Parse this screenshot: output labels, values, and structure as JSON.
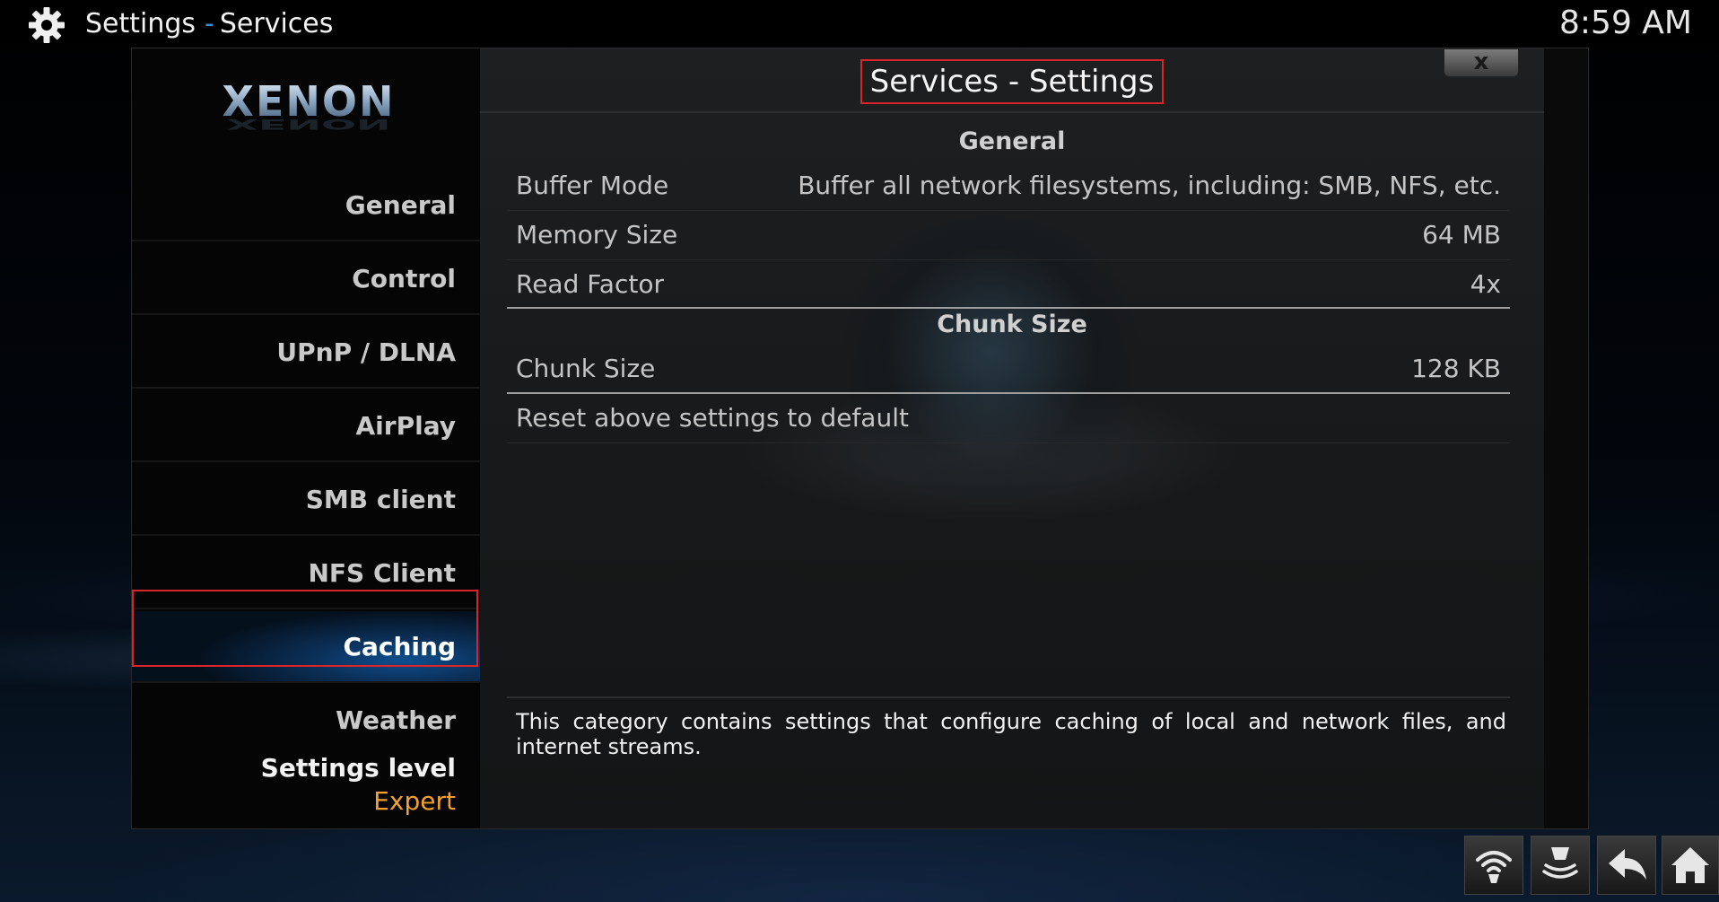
{
  "header": {
    "app": "Settings",
    "separator": "-",
    "section": "Services",
    "time": "8:59 AM"
  },
  "logo_text": "XENON",
  "sidebar": {
    "items": [
      {
        "label": "General"
      },
      {
        "label": "Control"
      },
      {
        "label": "UPnP / DLNA"
      },
      {
        "label": "AirPlay"
      },
      {
        "label": "SMB client"
      },
      {
        "label": "NFS Client"
      },
      {
        "label": "Caching",
        "selected": true
      },
      {
        "label": "Weather"
      }
    ],
    "settings_level_label": "Settings level",
    "settings_level_value": "Expert"
  },
  "dialog": {
    "title": "Services - Settings",
    "close_glyph": "x",
    "sections": [
      {
        "heading": "General",
        "rows": [
          {
            "label": "Buffer Mode",
            "value": "Buffer all network filesystems, including: SMB, NFS, etc."
          },
          {
            "label": "Memory Size",
            "value": "64 MB"
          },
          {
            "label": "Read Factor",
            "value": "4x"
          }
        ]
      },
      {
        "heading": "Chunk Size",
        "rows": [
          {
            "label": "Chunk Size",
            "value": "128 KB"
          }
        ]
      }
    ],
    "reset_label": "Reset above settings to default",
    "description": "This category contains settings that configure caching of local and network files, and internet streams."
  },
  "bottom_buttons": [
    "wifi-icon",
    "eject-icon",
    "back-arrow-icon",
    "home-icon"
  ],
  "colors": {
    "accent_blue": "#3b8fd9",
    "highlight_red": "#d9252a",
    "level_orange": "#f2a12a"
  }
}
